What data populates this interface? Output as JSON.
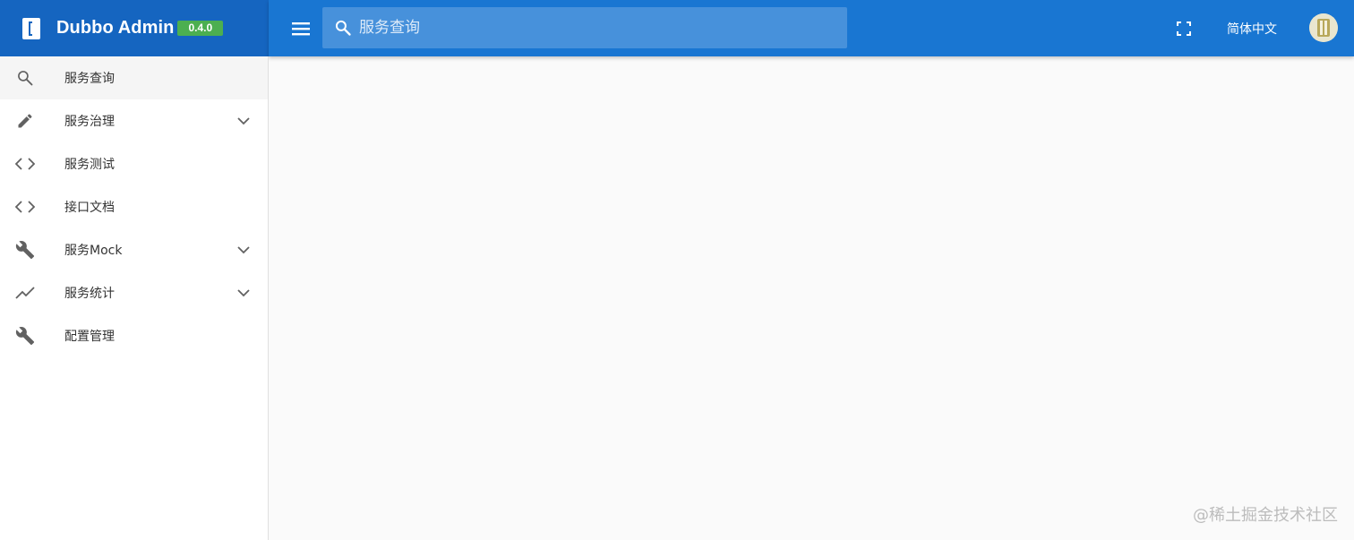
{
  "brand": {
    "title": "Dubbo Admin",
    "version": "0.4.0",
    "bar_color": "#1565c0",
    "badge_color": "#4caf50"
  },
  "topbar": {
    "color": "#1976d2",
    "menu_icon": "menu-icon",
    "search": {
      "icon": "search-icon",
      "placeholder": "服务查询",
      "value": ""
    },
    "fullscreen_icon": "fullscreen-icon",
    "language": "简体中文",
    "avatar": "avatar"
  },
  "sidebar": {
    "items": [
      {
        "label": "服务查询",
        "icon": "search-icon",
        "active": true,
        "expandable": false
      },
      {
        "label": "服务治理",
        "icon": "pencil-icon",
        "active": false,
        "expandable": true
      },
      {
        "label": "服务测试",
        "icon": "code-icon",
        "active": false,
        "expandable": false
      },
      {
        "label": "接口文档",
        "icon": "code-icon",
        "active": false,
        "expandable": false
      },
      {
        "label": "服务Mock",
        "icon": "wrench-icon",
        "active": false,
        "expandable": true
      },
      {
        "label": "服务统计",
        "icon": "trending-up-icon",
        "active": false,
        "expandable": true
      },
      {
        "label": "配置管理",
        "icon": "wrench-icon",
        "active": false,
        "expandable": false
      }
    ]
  },
  "watermark": "@稀土掘金技术社区"
}
